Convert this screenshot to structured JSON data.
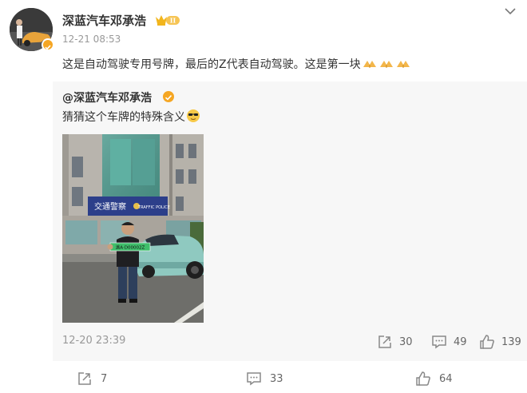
{
  "post": {
    "author": "深蓝汽车邓承浩",
    "level_badge": "II",
    "timestamp": "12-21 08:53",
    "text": "这是自动驾驶专用号牌，最后的Z代表自动驾驶。这是第一块",
    "emoji_count": 3
  },
  "repost": {
    "author": "@深蓝汽车邓承浩",
    "text": "猜猜这个车牌的特殊含义",
    "timestamp": "12-20 23:39",
    "photo": {
      "building_sign": "交通警察",
      "building_sign_en": "TRAFFIC POLICE",
      "plate": "渝A·D00002Z"
    },
    "share_count": "30",
    "comment_count": "49",
    "like_count": "139"
  },
  "actions": {
    "share_count": "7",
    "comment_count": "33",
    "like_count": "64"
  },
  "colors": {
    "text": "#333333",
    "muted": "#999999",
    "verified": "#f5a623",
    "repost_bg": "#f7f7f7"
  },
  "icons": {
    "share": "share-icon",
    "comment": "comment-icon",
    "like": "thumbs-up-icon",
    "more": "chevron-down-icon"
  }
}
